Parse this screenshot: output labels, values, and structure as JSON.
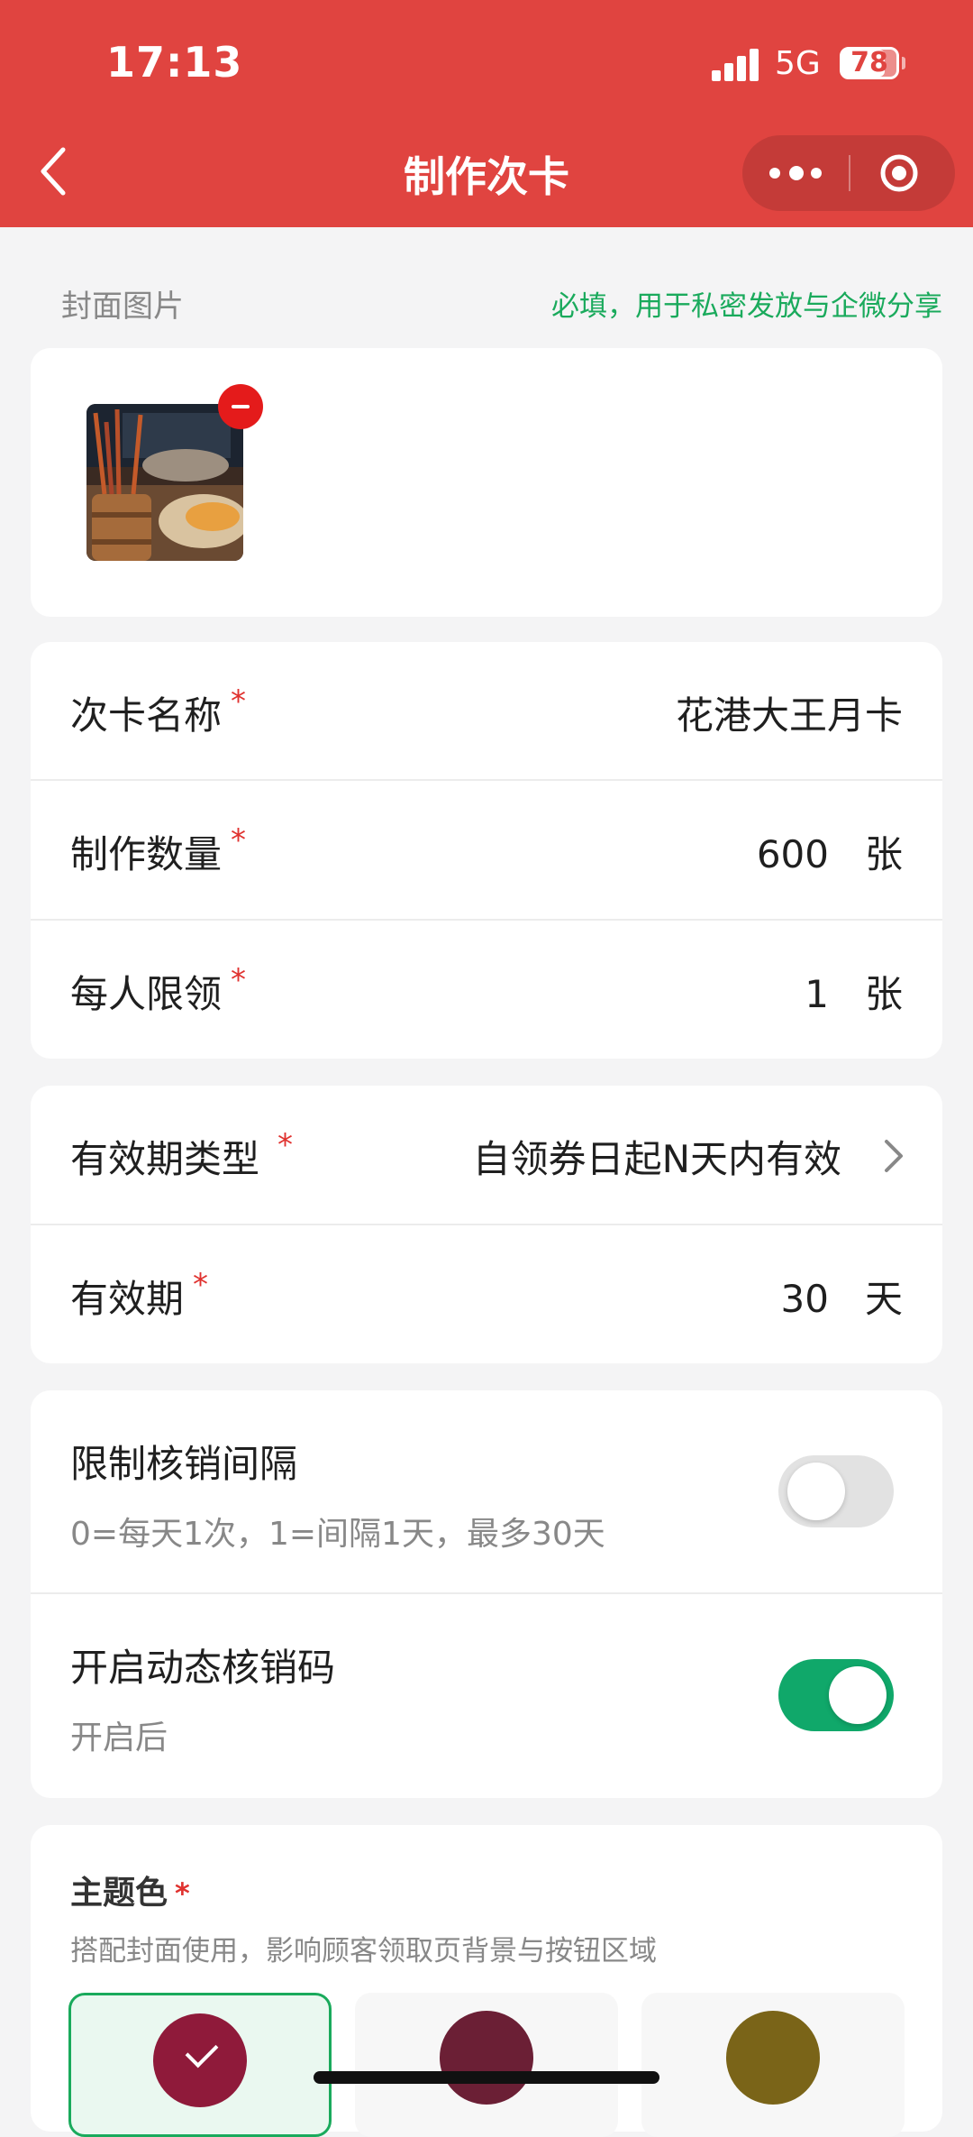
{
  "status_bar": {
    "time": "17:13",
    "network": "5G",
    "battery": "78"
  },
  "nav": {
    "title": "制作次卡"
  },
  "cover": {
    "label": "封面图片",
    "hint": "必填，用于私密发放与企微分享"
  },
  "fields": {
    "name": {
      "label": "次卡名称",
      "star": "*",
      "value": "花港大王月卡"
    },
    "quantity": {
      "label": "制作数量",
      "star": "*",
      "value": "600",
      "unit": "张"
    },
    "per_person": {
      "label": "每人限领",
      "star": "*",
      "value": "1",
      "unit": "张"
    },
    "validity_type": {
      "label": "有效期类型",
      "star": "*",
      "value": "自领券日起N天内有效"
    },
    "validity": {
      "label": "有效期",
      "star": "*",
      "value": "30",
      "unit": "天"
    }
  },
  "toggles": {
    "limit_interval": {
      "label": "限制核销间隔",
      "desc": "0=每天1次，1=间隔1天，最多30天",
      "on": false
    },
    "dynamic_code": {
      "label": "开启动态核销码",
      "desc": "开启后",
      "on": true
    }
  },
  "theme": {
    "title": "主题色",
    "star": "*",
    "desc": "搭配封面使用，影响顾客领取页背景与按钮区域",
    "swatches": [
      {
        "color": "#8f1a3a",
        "selected": true
      },
      {
        "color": "#6b1f35",
        "selected": false
      },
      {
        "color": "#7a6418",
        "selected": false
      }
    ]
  },
  "colors": {
    "header": "#e04440",
    "accent_green": "#1aaa5c",
    "toggle_on": "#10a86a"
  }
}
